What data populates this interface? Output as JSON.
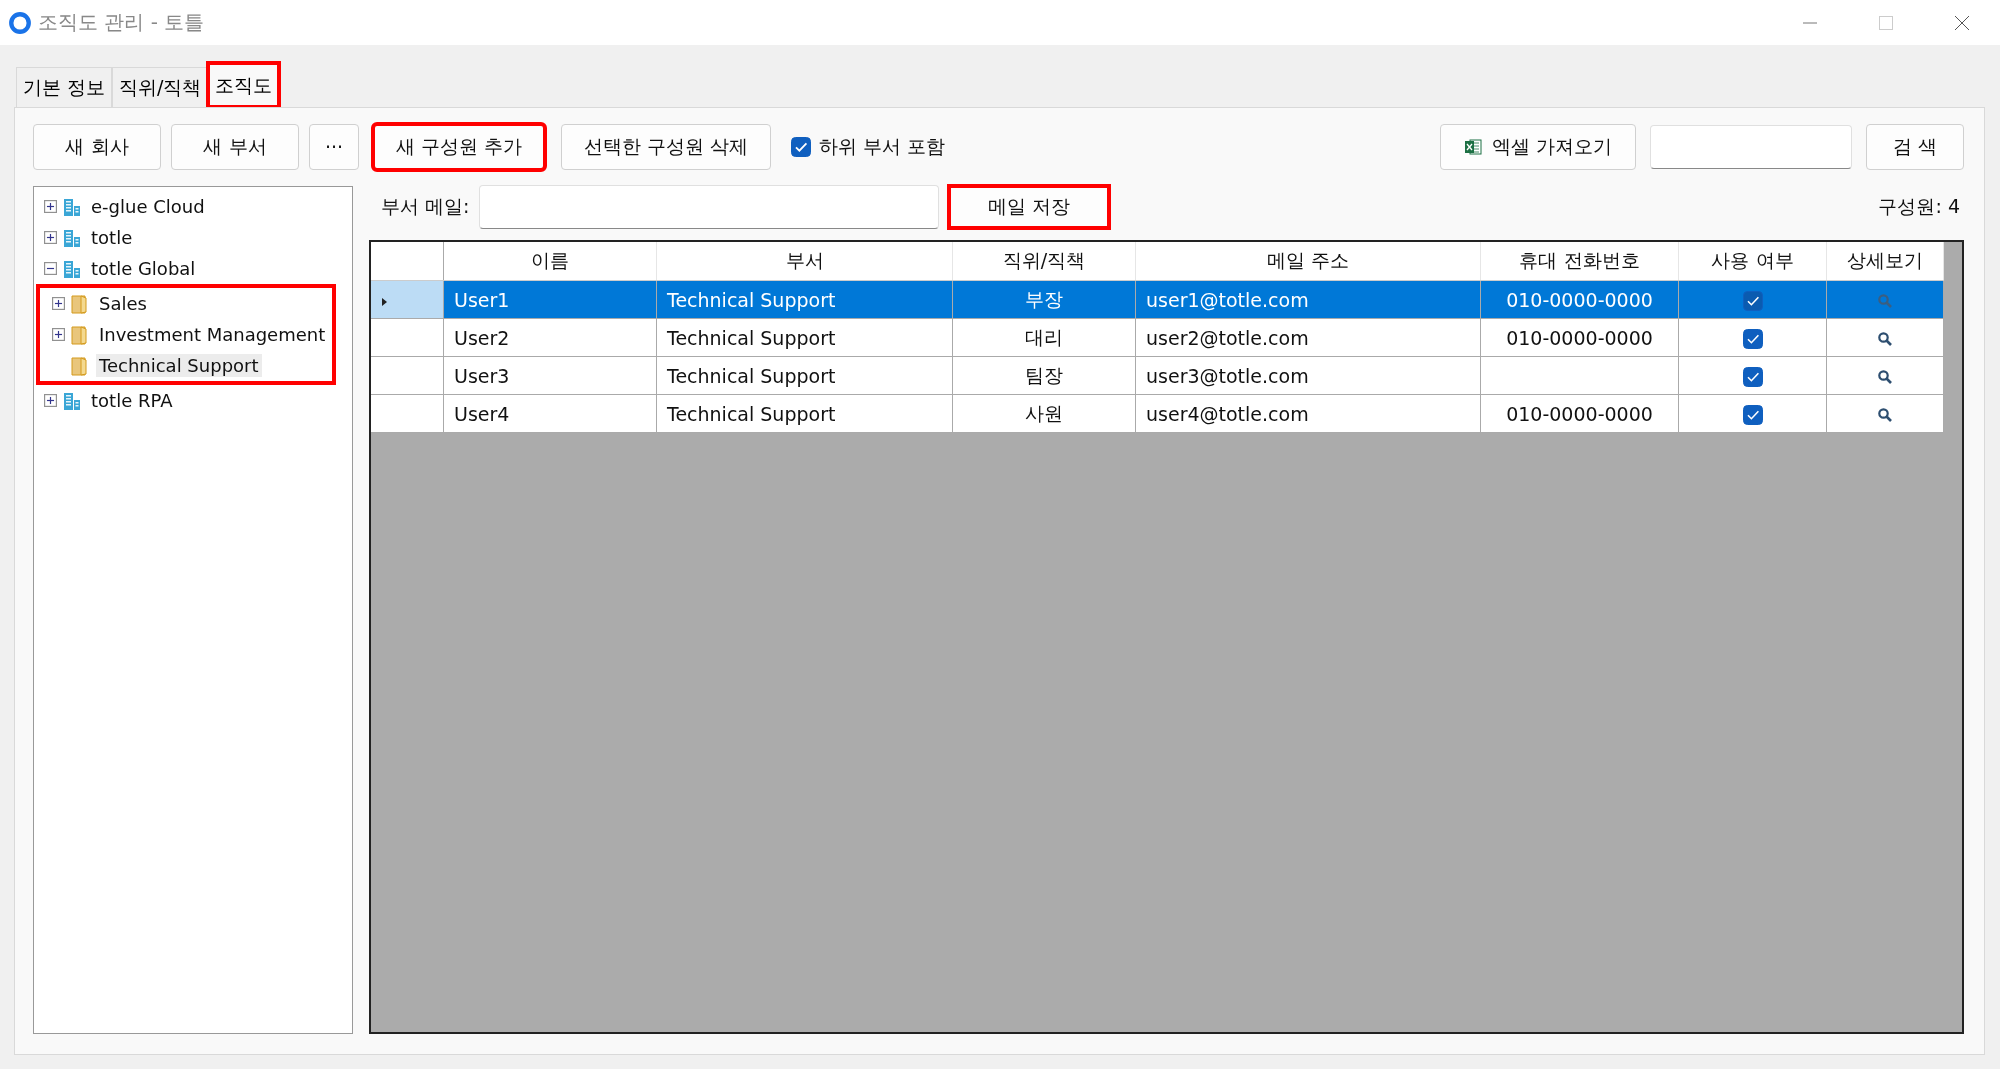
{
  "window": {
    "title": "조직도 관리 - 토틀"
  },
  "tabs": [
    {
      "label": "기본 정보",
      "selected": false,
      "highlighted": false
    },
    {
      "label": "직위/직책",
      "selected": false,
      "highlighted": false
    },
    {
      "label": "조직도",
      "selected": true,
      "highlighted": true
    }
  ],
  "toolbar": {
    "buttons": [
      {
        "label": "새 회사",
        "highlighted": false
      },
      {
        "label": "새 부서",
        "highlighted": false
      },
      {
        "label": "···",
        "highlighted": false
      },
      {
        "label": "새 구성원 추가",
        "highlighted": true
      },
      {
        "label": "선택한 구성원 삭제",
        "highlighted": false
      }
    ],
    "include_subdepartments": {
      "label": "하위 부서 포함",
      "checked": true
    },
    "excel_button": {
      "label": "엑셀 가져오기"
    },
    "search_button": {
      "label": "검 색"
    }
  },
  "tree": [
    {
      "label": "e-glue Cloud",
      "kind": "company",
      "expanded": false,
      "selected": false
    },
    {
      "label": "totle",
      "kind": "company",
      "expanded": false,
      "selected": false
    },
    {
      "label": "totle Global",
      "kind": "company",
      "expanded": true,
      "selected": false,
      "children_highlighted": true,
      "children": [
        {
          "label": "Sales",
          "kind": "department",
          "expanded": false,
          "selected": false
        },
        {
          "label": "Investment Management",
          "kind": "department",
          "expanded": false,
          "selected": false
        },
        {
          "label": "Technical Support",
          "kind": "department",
          "selected": true
        }
      ]
    },
    {
      "label": "totle RPA",
      "kind": "company",
      "expanded": false,
      "selected": false
    }
  ],
  "department_mail": {
    "label": "부서 메일:",
    "save_button": {
      "label": "메일 저장",
      "highlighted": true
    }
  },
  "member_count": "구성원: 4",
  "table": {
    "columns": [
      "이름",
      "부서",
      "직위/직책",
      "메일 주소",
      "휴대 전화번호",
      "사용 여부",
      "상세보기"
    ],
    "rows": [
      {
        "selected": true,
        "name": "User1",
        "department": "Technical Support",
        "position": "부장",
        "email": "user1@totle.com",
        "phone": "010-0000-0000",
        "active": true
      },
      {
        "selected": false,
        "name": "User2",
        "department": "Technical Support",
        "position": "대리",
        "email": "user2@totle.com",
        "phone": "010-0000-0000",
        "active": true
      },
      {
        "selected": false,
        "name": "User3",
        "department": "Technical Support",
        "position": "팀장",
        "email": "user3@totle.com",
        "phone": "",
        "active": true
      },
      {
        "selected": false,
        "name": "User4",
        "department": "Technical Support",
        "position": "사원",
        "email": "user4@totle.com",
        "phone": "010-0000-0000",
        "active": true
      }
    ]
  }
}
